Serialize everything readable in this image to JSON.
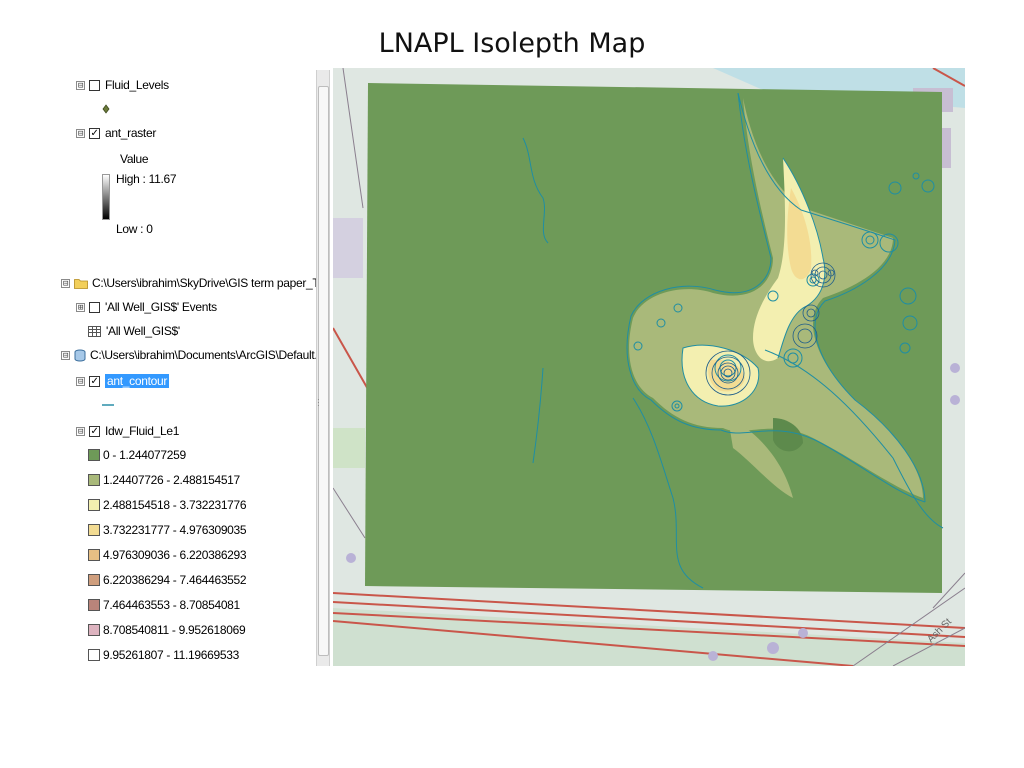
{
  "page": {
    "title": "LNAPL Isolepth Map"
  },
  "toc": {
    "fluid_levels": {
      "label": "Fluid_Levels",
      "expander": "⊟",
      "checked": false
    },
    "ant_raster": {
      "label": "ant_raster",
      "expander": "⊟",
      "checked": true,
      "value_label": "Value",
      "high": "High : 11.67",
      "low": "Low : 0"
    },
    "folder": {
      "label": "C:\\Users\\ibrahim\\SkyDrive\\GIS term paper_Thesis\\da",
      "expander": "⊟"
    },
    "events": {
      "label": "'All Well_GIS$' Events",
      "expander": "⊞",
      "checked": false
    },
    "table": {
      "label": "'All Well_GIS$'"
    },
    "gdb": {
      "label": "C:\\Users\\ibrahim\\Documents\\ArcGIS\\Default.gdb",
      "expander": "⊟"
    },
    "ant_contour": {
      "label": "ant_contour",
      "expander": "⊟",
      "checked": true
    },
    "idw": {
      "label": "Idw_Fluid_Le1",
      "expander": "⊟",
      "checked": true,
      "classes": [
        {
          "label": "0 - 1.244077259",
          "color": "#6e9a58"
        },
        {
          "label": "1.24407726 - 2.488154517",
          "color": "#a9b97a"
        },
        {
          "label": "2.488154518 - 3.732231776",
          "color": "#f3efb0"
        },
        {
          "label": "3.732231777 - 4.976309035",
          "color": "#f3dc93"
        },
        {
          "label": "4.976309036 - 6.220386293",
          "color": "#e7bf84"
        },
        {
          "label": "6.220386294 - 7.464463552",
          "color": "#cf9e7d"
        },
        {
          "label": "7.464463553 - 8.70854081",
          "color": "#b9847a"
        },
        {
          "label": "8.708540811 - 9.952618069",
          "color": "#ddb3bf"
        },
        {
          "label": "9.95261807 - 11.19669533",
          "color": "#ffffff"
        }
      ]
    }
  },
  "map": {
    "street_label": "Ash St"
  }
}
